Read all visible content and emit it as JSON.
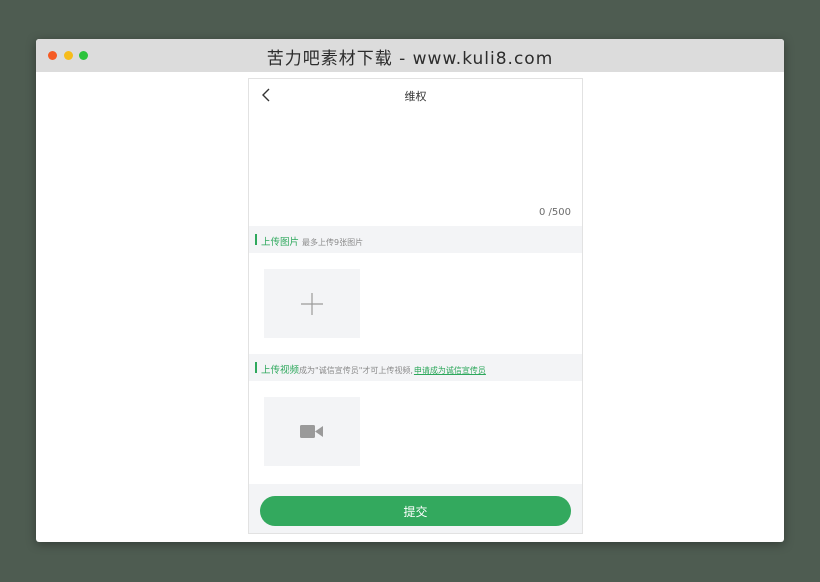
{
  "window": {
    "title": "苦力吧素材下载 - www.kuli8.com"
  },
  "nav": {
    "title": "维权",
    "back_icon": "chevron-left-icon"
  },
  "complaint": {
    "value": "",
    "counter": "0 /500"
  },
  "photos": {
    "label": "上传图片",
    "hint": "最多上传9张图片",
    "add_icon": "plus-icon"
  },
  "videos": {
    "label": "上传视频",
    "hint": "成为\"诚信宣传员\"才可上传视频,",
    "link": "申请成为诚信宣传员",
    "add_icon": "video-camera-icon"
  },
  "footer": {
    "submit_label": "提交"
  },
  "colors": {
    "accent": "#33a95e",
    "section_bg": "#f3f4f6",
    "page_bg": "#4e5c51"
  }
}
